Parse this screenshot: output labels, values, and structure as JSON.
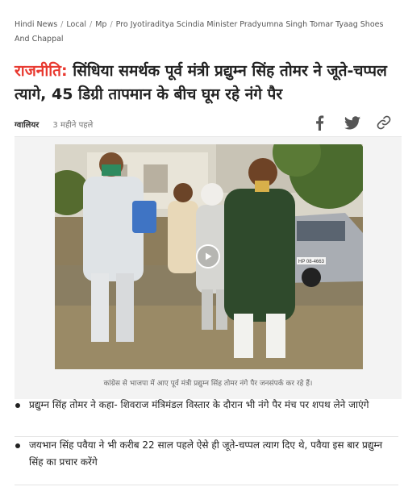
{
  "breadcrumb": {
    "items": [
      "Hindi News",
      "Local",
      "Mp",
      "Pro Jyotiraditya Scindia Minister Pradyumna Singh Tomar Tyaag Shoes And Chappal"
    ],
    "separator": "/"
  },
  "headline": {
    "category": "राजनीति:",
    "text": " सिंधिया समर्थक पूर्व मंत्री प्रद्युम्न सिंह तोमर ने जूते-चप्पल त्यागे, 45 डिग्री तापमान के बीच घूम रहे नंगे पैर"
  },
  "meta": {
    "city": "ग्वालियर",
    "time": "3 महीने पहले"
  },
  "share": {
    "icons": [
      "facebook-icon",
      "twitter-icon",
      "link-icon"
    ]
  },
  "media": {
    "caption": "कांग्रेस से भाजपा में आए पूर्व मंत्री प्रद्युम्न सिंह तोमर नंगे पैर जनसंपर्क कर रहे हैं।",
    "plate_text": "HP 08-4663"
  },
  "bullets": [
    "प्रद्युम्न सिंह तोमर ने कहा- शिवराज मंत्रिमंडल विस्तार के दौरान भी नंगे पैर मंच पर शपथ लेने जाएंगे",
    "जयभान सिंह पवैया ने भी करीब 22 साल पहले ऐसे ही जूते-चप्पल त्याग दिए थे, पवैया इस बार प्रद्युम्न सिंह का प्रचार करेंगे"
  ],
  "colors": {
    "category": "#e8382f",
    "text": "#222222"
  }
}
